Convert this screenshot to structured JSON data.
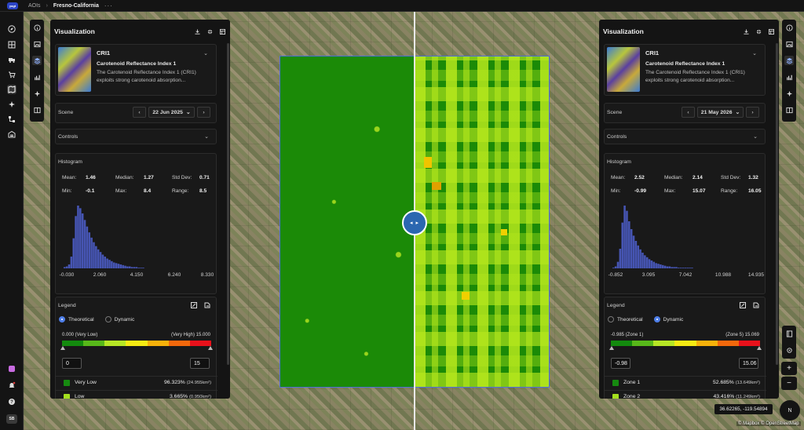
{
  "app": {
    "logo_text": "yagt"
  },
  "breadcrumb": {
    "root": "AOIs",
    "current": "Fresno-California",
    "more": "···"
  },
  "user": {
    "initials": "SB"
  },
  "map": {
    "coordinates": "36.62265, -119.54894",
    "attribution": "© Mapbox © OpenStreetMap",
    "compass": "N",
    "zoom_in": "+",
    "zoom_out": "−",
    "swipe_handle": "◂ ▸"
  },
  "panels": [
    {
      "title": "Visualization",
      "layer": {
        "name": "CRI1",
        "full_name": "Carotenoid Reflectance Index 1",
        "description": "The Carotenoid Reflectance Index 1 (CRI1) exploits strong carotenoid absorption..."
      },
      "scene": {
        "label": "Scene",
        "date": "22 Jun 2025",
        "prev": "‹",
        "next": "›"
      },
      "controls_label": "Controls",
      "histogram": {
        "label": "Histogram",
        "stats": {
          "mean_label": "Mean:",
          "mean": "1.46",
          "median_label": "Median:",
          "median": "1.27",
          "std_label": "Std Dev:",
          "std": "0.71",
          "min_label": "Min:",
          "min": "-0.1",
          "max_label": "Max:",
          "max": "8.4",
          "range_label": "Range:",
          "range": "8.5"
        },
        "ticks": [
          "-0.030",
          "2.060",
          "4.150",
          "6.240",
          "8.330"
        ],
        "bins": [
          2,
          3,
          6,
          18,
          46,
          80,
          96,
          92,
          84,
          74,
          64,
          55,
          47,
          40,
          34,
          29,
          25,
          21,
          18,
          15,
          13,
          11,
          9,
          8,
          7,
          6,
          5,
          4,
          3,
          3,
          2,
          2,
          2,
          1,
          1,
          1
        ]
      },
      "legend": {
        "label": "Legend",
        "mode_theoretical": "Theoretical",
        "mode_dynamic": "Dynamic",
        "selected_mode": "Theoretical",
        "range_min_label": "0.000 (Very Low)",
        "range_max_label": "(Very High) 15.000",
        "min_value": "0",
        "max_value": "15",
        "classes": [
          {
            "name": "Very Low",
            "pct": "96.323%",
            "area": "(24.955km²)",
            "color": "#168a10"
          },
          {
            "name": "Low",
            "pct": "3.665%",
            "area": "(0.950km²)",
            "color": "#a4e01e"
          }
        ]
      }
    },
    {
      "title": "Visualization",
      "layer": {
        "name": "CRI1",
        "full_name": "Carotenoid Reflectance Index 1",
        "description": "The Carotenoid Reflectance Index 1 (CRI1) exploits strong carotenoid absorption..."
      },
      "scene": {
        "label": "Scene",
        "date": "21 May 2026",
        "prev": "‹",
        "next": "›"
      },
      "controls_label": "Controls",
      "histogram": {
        "label": "Histogram",
        "stats": {
          "mean_label": "Mean:",
          "mean": "2.52",
          "median_label": "Median:",
          "median": "2.14",
          "std_label": "Std Dev:",
          "std": "1.32",
          "min_label": "Min:",
          "min": "-0.99",
          "max_label": "Max:",
          "max": "15.07",
          "range_label": "Range:",
          "range": "16.05"
        },
        "ticks": [
          "-0.852",
          "3.095",
          "7.042",
          "10.988",
          "14.935"
        ],
        "bins": [
          1,
          3,
          10,
          30,
          70,
          96,
          88,
          72,
          60,
          50,
          42,
          35,
          29,
          24,
          20,
          17,
          14,
          12,
          10,
          8,
          7,
          6,
          5,
          4,
          3,
          3,
          2,
          2,
          2,
          1,
          1,
          1,
          1,
          1,
          1,
          1
        ]
      },
      "legend": {
        "label": "Legend",
        "mode_theoretical": "Theoretical",
        "mode_dynamic": "Dynamic",
        "selected_mode": "Dynamic",
        "range_min_label": "-0.985 (Zone 1)",
        "range_max_label": "(Zone 5) 15.069",
        "min_value": "-0.98",
        "max_value": "15.06",
        "classes": [
          {
            "name": "Zone 1",
            "pct": "52.685%",
            "area": "(13.649km²)",
            "color": "#168a10"
          },
          {
            "name": "Zone 2",
            "pct": "43.416%",
            "area": "(11.249km²)",
            "color": "#a4e01e"
          }
        ]
      }
    }
  ],
  "colors": {
    "ramp": [
      "#138a0e",
      "#58b81a",
      "#b6e625",
      "#f5ea13",
      "#f6b10a",
      "#f2680c",
      "#e8111b"
    ],
    "accent": "#4f7fe8",
    "histogram_bar": "#4655b3"
  }
}
